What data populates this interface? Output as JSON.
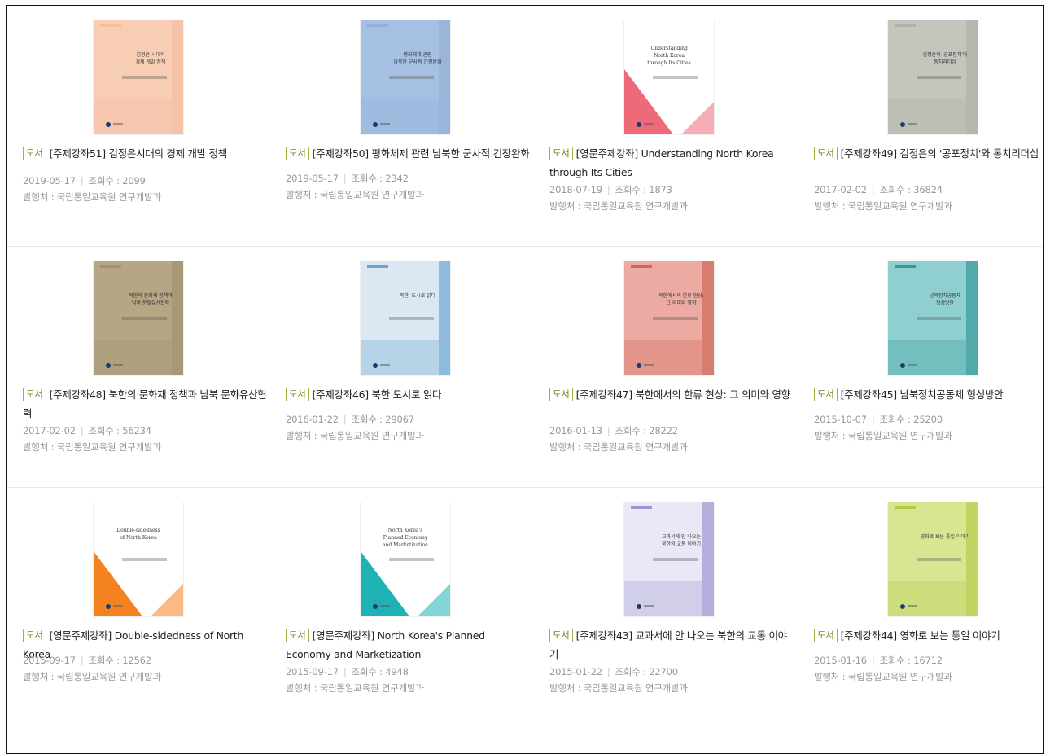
{
  "tag_label": "도서",
  "views_label": "조회수 : ",
  "publisher_label": "발행처 : ",
  "books": [
    {
      "title": "[주제강좌51] 김정은시대의 경제 개발 정책",
      "date": "2019-05-17",
      "views": "2099",
      "publisher": "국립통일교육원 연구개발과",
      "cover": {
        "bg": "#f7cdb4",
        "accent": "#f3b99b",
        "text1": "김정은 시대의",
        "text2": "경제 개발 정책",
        "text3": ""
      }
    },
    {
      "title": "[주제강좌50] 평화체제 관련 남북한 군사적 긴장완화",
      "date": "2019-05-17",
      "views": "2342",
      "publisher": "국립통일교육원 연구개발과",
      "cover": {
        "bg": "#a6c0e4",
        "accent": "#8faad2",
        "text1": "평화체제 관련",
        "text2": "남북한 군사적 긴장완화",
        "text3": ""
      }
    },
    {
      "title": "[영문주제강좌] Understanding North Korea through Its Cities",
      "date": "2018-07-19",
      "views": "1873",
      "publisher": "국립통일교육원 연구개발과",
      "cover": {
        "bg": "#ffffff",
        "accent": "#ee6a79",
        "text1": "Understanding",
        "text2": "North Korea",
        "text3": "through Its Cities"
      }
    },
    {
      "title": "[주제강좌49] 김정은의 '공포정치'와 통치리더십",
      "date": "2017-02-02",
      "views": "36824",
      "publisher": "국립통일교육원 연구개발과",
      "cover": {
        "bg": "#c3c6bd",
        "accent": "#a9ad9f",
        "text1": "김정은의 '공포정치'와",
        "text2": "통치리더십",
        "text3": ""
      }
    },
    {
      "title": "[주제강좌48] 북한의 문화재 정책과 남북 문화유산협력",
      "date": "2017-02-02",
      "views": "56234",
      "publisher": "국립통일교육원 연구개발과",
      "cover": {
        "bg": "#b5a684",
        "accent": "#9d8e6c",
        "text1": "북한의 문화재 정책과",
        "text2": "남북 문화유산협력",
        "text3": ""
      }
    },
    {
      "title": "[주제강좌46] 북한 도시로 읽다",
      "date": "2016-01-22",
      "views": "29067",
      "publisher": "국립통일교육원 연구개발과",
      "cover": {
        "bg": "#dbe8f3",
        "accent": "#4d95c9",
        "text1": "북한, 도시로 읽다",
        "text2": "",
        "text3": ""
      }
    },
    {
      "title": "[주제강좌47] 북한에서의 한류 현상: 그 의미와 영향",
      "date": "2016-01-13",
      "views": "28222",
      "publisher": "국립통일교육원 연구개발과",
      "cover": {
        "bg": "#ecaaa2",
        "accent": "#c85546",
        "text1": "북한에서의 한류 현상:",
        "text2": "그 의미와 영향",
        "text3": ""
      }
    },
    {
      "title": "[주제강좌45] 남북정치공동체 형성방안",
      "date": "2015-10-07",
      "views": "25200",
      "publisher": "국립통일교육원 연구개발과",
      "cover": {
        "bg": "#8fcfcf",
        "accent": "#1f8b8c",
        "text1": "남북정치공동체",
        "text2": "형성방안",
        "text3": ""
      }
    },
    {
      "title": "[영문주제강좌] Double-sidedness of North Korea",
      "date": "2015-09-17",
      "views": "12562",
      "publisher": "국립통일교육원 연구개발과",
      "cover": {
        "bg": "#ffffff",
        "accent": "#f58220",
        "text1": "Double-sidedness",
        "text2": "of North Korea",
        "text3": ""
      }
    },
    {
      "title": "[영문주제강좌] North Korea's Planned Economy and Marketization",
      "date": "2015-09-17",
      "views": "4948",
      "publisher": "국립통일교육원 연구개발과",
      "cover": {
        "bg": "#ffffff",
        "accent": "#1eb2b5",
        "text1": "North Korea's",
        "text2": "Planned Economy",
        "text3": "and Marketization"
      }
    },
    {
      "title": "[주제강좌43] 교과서에 안 나오는 북한의 교통 이야기",
      "date": "2015-01-22",
      "views": "22700",
      "publisher": "국립통일교육원 연구개발과",
      "cover": {
        "bg": "#e8e8f6",
        "accent": "#8a7fc7",
        "text1": "교과서에 안 나오는",
        "text2": "북한의 교통 이야기",
        "text3": ""
      }
    },
    {
      "title": "[주제강좌44] 영화로 보는 통일 이야기",
      "date": "2015-01-16",
      "views": "16712",
      "publisher": "국립통일교육원 연구개발과",
      "cover": {
        "bg": "#d9e691",
        "accent": "#a9c43a",
        "text1": "영화로 보는 통일 이야기",
        "text2": "",
        "text3": ""
      }
    }
  ]
}
